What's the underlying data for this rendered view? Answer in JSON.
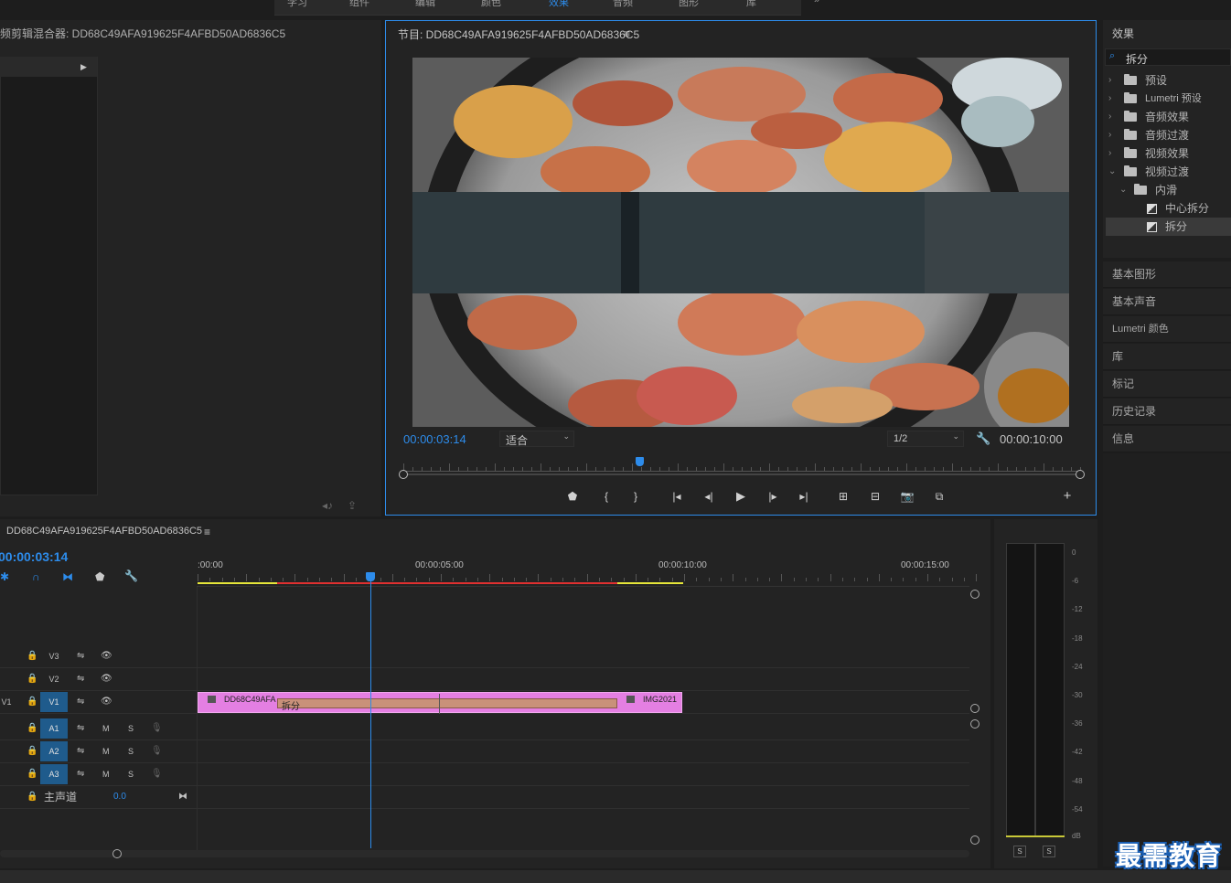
{
  "top_menu": [
    "学习",
    "组件",
    "编辑",
    "颜色",
    "效果",
    "音频",
    "图形",
    "库",
    "»"
  ],
  "source_panel": {
    "title": "频剪辑混合器: DD68C49AFA919625F4AFBD50AD6836C5"
  },
  "program_monitor": {
    "title": "节目: DD68C49AFA919625F4AFBD50AD6836C5",
    "menu_icon": "hamburger-icon",
    "current_time": "00:00:03:14",
    "fit_label": "适合",
    "resolution": "1/2",
    "duration": "00:00:10:00"
  },
  "effects_panel": {
    "title": "效果",
    "search_value": "拆分",
    "tree": [
      {
        "label": "预设",
        "type": "preset-folder",
        "level": 0,
        "expanded": false
      },
      {
        "label": "Lumetri 预设",
        "type": "preset-folder",
        "level": 0,
        "expanded": false
      },
      {
        "label": "音频效果",
        "type": "folder",
        "level": 0,
        "expanded": false
      },
      {
        "label": "音频过渡",
        "type": "folder",
        "level": 0,
        "expanded": false
      },
      {
        "label": "视频效果",
        "type": "folder",
        "level": 0,
        "expanded": false
      },
      {
        "label": "视频过渡",
        "type": "folder",
        "level": 0,
        "expanded": true
      },
      {
        "label": "内滑",
        "type": "folder",
        "level": 1,
        "expanded": true
      },
      {
        "label": "中心拆分",
        "type": "item",
        "level": 2
      },
      {
        "label": "拆分",
        "type": "item",
        "level": 2,
        "selected": true
      }
    ]
  },
  "side_panels": [
    "基本图形",
    "基本声音",
    "Lumetri 颜色",
    "库",
    "标记",
    "历史记录",
    "信息"
  ],
  "timeline": {
    "title": "DD68C49AFA919625F4AFBD50AD6836C5",
    "current_time": "00:00:03:14",
    "ruler_labels": [
      ":00:00",
      "00:00:05:00",
      "00:00:10:00",
      "00:00:15:00"
    ],
    "video_tracks": [
      {
        "label": "V3",
        "source": ""
      },
      {
        "label": "V2",
        "source": ""
      },
      {
        "label": "V1",
        "source": "V1"
      }
    ],
    "audio_tracks": [
      {
        "label": "A1",
        "m": "M",
        "s": "S"
      },
      {
        "label": "A2",
        "m": "M",
        "s": "S"
      },
      {
        "label": "A3",
        "m": "M",
        "s": "S"
      }
    ],
    "master": {
      "label": "主声道",
      "value": "0.0"
    },
    "clips": {
      "clip1": "DD68C49AFA",
      "transition": "拆分",
      "clip2": "IMG2021"
    }
  },
  "audio_meter": {
    "labels": [
      "0",
      "-6",
      "-12",
      "-18",
      "-24",
      "-30",
      "-36",
      "-42",
      "-48",
      "-54",
      "dB"
    ],
    "solo_left": "S",
    "solo_right": "S"
  },
  "watermark": "最需教育",
  "colors": {
    "accent_blue": "#2d8ceb",
    "clip_pink": "#e47fe2",
    "transition_tan": "#c9917a",
    "track_on": "#1f5b8c"
  }
}
